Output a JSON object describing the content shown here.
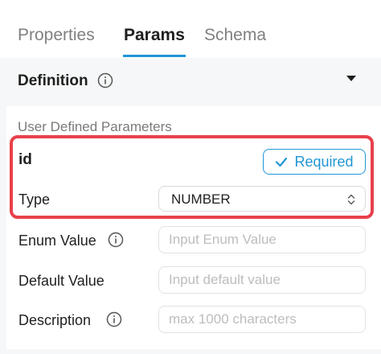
{
  "tabs": [
    {
      "label": "Properties"
    },
    {
      "label": "Params"
    },
    {
      "label": "Schema"
    }
  ],
  "definition": {
    "title": "Definition"
  },
  "section": {
    "title": "User Defined Parameters"
  },
  "param": {
    "name": "id",
    "required_label": "Required",
    "type_label": "Type",
    "type_value": "NUMBER"
  },
  "fields": {
    "enum_label": "Enum Value",
    "enum_placeholder": "Input Enum Value",
    "default_label": "Default Value",
    "default_placeholder": "Input default value",
    "description_label": "Description",
    "description_placeholder": "max 1000 characters"
  },
  "colors": {
    "accent": "#2196d6",
    "highlight": "#e8414b"
  }
}
